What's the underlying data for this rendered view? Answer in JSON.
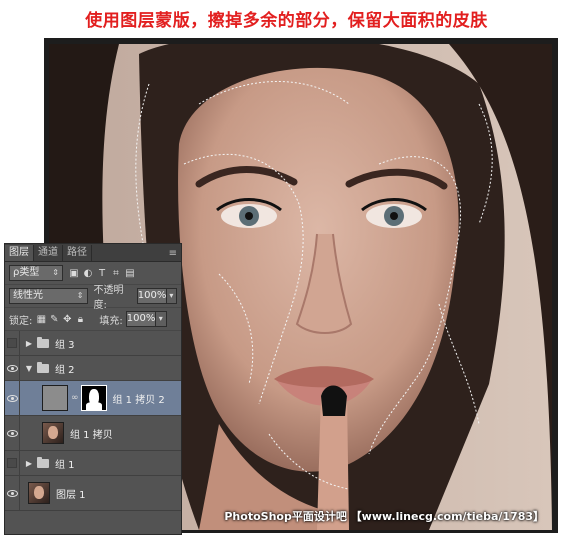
{
  "title": "使用图层蒙版，擦掉多余的部分，保留大面积的皮肤",
  "watermark": "PhotoShop平面设计吧 【www.linecg.com/tieba/1783】",
  "panel": {
    "tabs": [
      "图层",
      "通道",
      "路径"
    ],
    "filter_label": "ρ类型",
    "blend_mode": "线性光",
    "opacity_label": "不透明度:",
    "opacity_value": "100%",
    "lock_label": "锁定:",
    "fill_label": "填充:",
    "fill_value": "100%",
    "layers": [
      {
        "name": "组 3",
        "type": "group",
        "visible": false,
        "expanded": false
      },
      {
        "name": "组 2",
        "type": "group",
        "visible": true,
        "expanded": true
      },
      {
        "name": "组 1 拷贝 2",
        "type": "layer-mask",
        "visible": true,
        "selected": true
      },
      {
        "name": "组 1 拷贝",
        "type": "layer",
        "visible": true
      },
      {
        "name": "组 1",
        "type": "group",
        "visible": false,
        "expanded": false
      },
      {
        "name": "图层 1",
        "type": "layer",
        "visible": true
      }
    ]
  },
  "colors": {
    "title": "#e21f1f",
    "panel_bg": "#535353",
    "selected_row": "#6f7f98"
  }
}
